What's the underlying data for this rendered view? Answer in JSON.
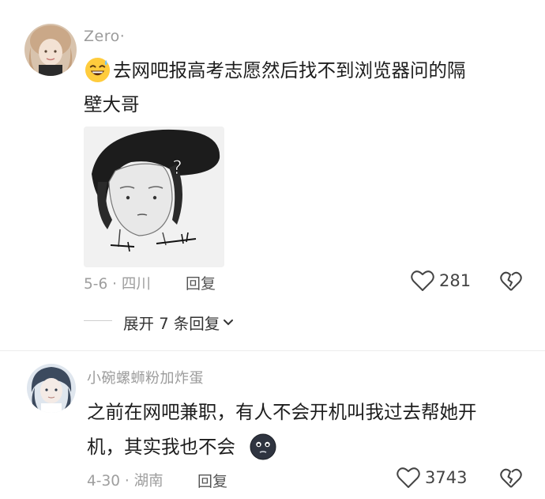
{
  "comments": [
    {
      "username": "Zero·",
      "text_line1": "去网吧报高考志愿然后找不到浏览器问的隔",
      "text_line2": "壁大哥",
      "emoji": "grinning-sweat-emoji",
      "date_location": "5-6 · 四川",
      "reply_label": "回复",
      "likes": "281",
      "expand_replies": "展开 7 条回复"
    },
    {
      "username": "小碗螺蛳粉加炸蛋",
      "text_line1": "之前在网吧兼职，有人不会开机叫我过去帮她开",
      "text_line2": "机，其实我也不会",
      "emoji": "sigh-face-emoji",
      "date_location": "4-30 · 湖南",
      "reply_label": "回复",
      "likes": "3743"
    }
  ],
  "colors": {
    "meta_gray": "#9e9e9e",
    "text_dark": "#1d1d1d"
  }
}
